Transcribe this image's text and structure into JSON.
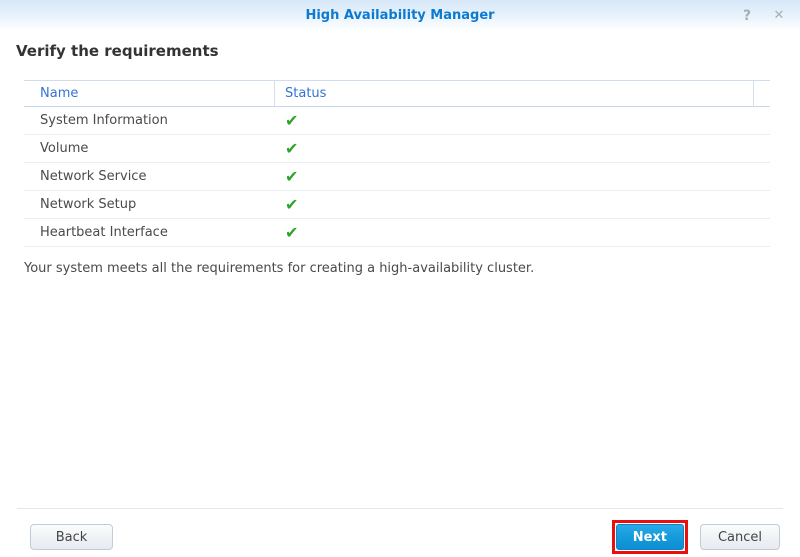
{
  "window": {
    "title": "High Availability Manager",
    "help_icon": "?",
    "close_icon": "✕"
  },
  "page": {
    "heading": "Verify the requirements",
    "message": "Your system meets all the requirements for creating a high-availability cluster."
  },
  "table": {
    "columns": [
      "Name",
      "Status"
    ],
    "check_icon": "✔",
    "rows": [
      {
        "name": "System Information",
        "status": "pass"
      },
      {
        "name": "Volume",
        "status": "pass"
      },
      {
        "name": "Network Service",
        "status": "pass"
      },
      {
        "name": "Network Setup",
        "status": "pass"
      },
      {
        "name": "Heartbeat Interface",
        "status": "pass"
      }
    ]
  },
  "footer": {
    "back_label": "Back",
    "next_label": "Next",
    "cancel_label": "Cancel"
  },
  "annotation": {
    "highlighted_button": "Next",
    "outline_color": "#e8100c"
  },
  "colors": {
    "title_blue": "#0d7ad1",
    "header_blue": "#3573d4",
    "check_green": "#2ea32c",
    "next_button_blue": "#1499da"
  }
}
